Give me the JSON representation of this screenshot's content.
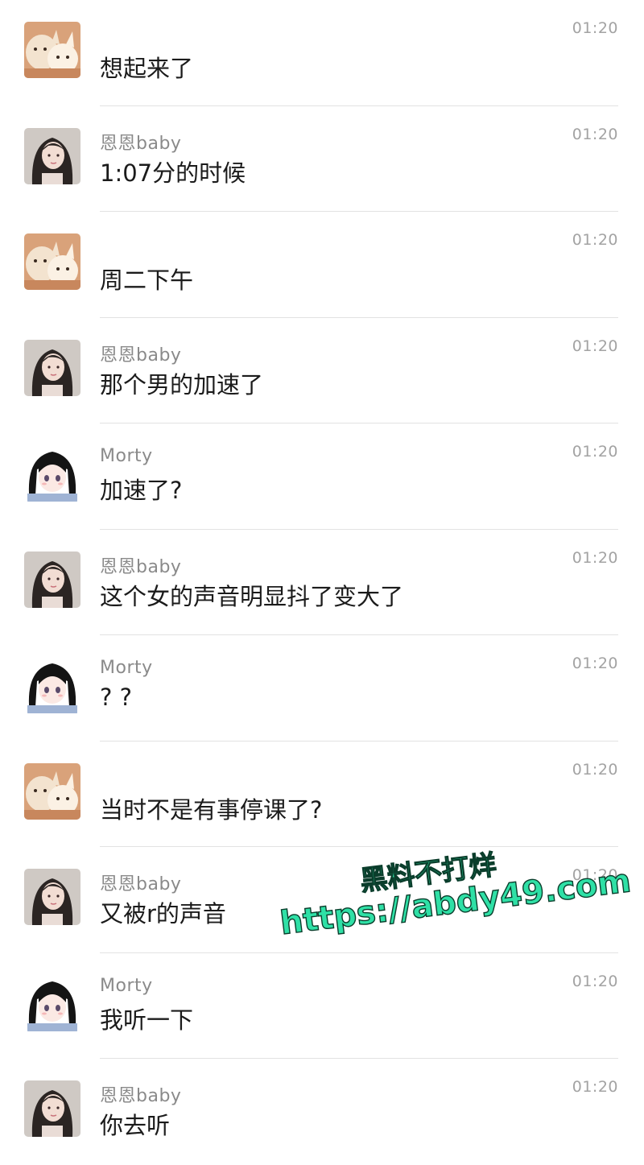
{
  "messages": [
    {
      "avatar": "cat",
      "sender": "",
      "text": "想起来了",
      "time": "01:20"
    },
    {
      "avatar": "girl",
      "sender": "恩恩baby",
      "text": "1:07分的时候",
      "time": "01:20"
    },
    {
      "avatar": "cat",
      "sender": "",
      "text": "周二下午",
      "time": "01:20"
    },
    {
      "avatar": "girl",
      "sender": "恩恩baby",
      "text": "那个男的加速了",
      "time": "01:20"
    },
    {
      "avatar": "anime",
      "sender": "Morty",
      "text": "加速了?",
      "time": "01:20"
    },
    {
      "avatar": "girl",
      "sender": "恩恩baby",
      "text": "这个女的声音明显抖了变大了",
      "time": "01:20"
    },
    {
      "avatar": "anime",
      "sender": "Morty",
      "text": "? ?",
      "time": "01:20"
    },
    {
      "avatar": "cat",
      "sender": "",
      "text": "当时不是有事停课了?",
      "time": "01:20"
    },
    {
      "avatar": "girl",
      "sender": "恩恩baby",
      "text": "又被r的声音",
      "time": "01:20"
    },
    {
      "avatar": "anime",
      "sender": "Morty",
      "text": "我听一下",
      "time": "01:20"
    },
    {
      "avatar": "girl",
      "sender": "恩恩baby",
      "text": "你去听",
      "time": "01:20"
    }
  ],
  "watermark": {
    "line1": "黑料不打烊",
    "line2": "https://abdy49.com"
  },
  "colors": {
    "sender": "#8a8a8a",
    "message": "#1b1b1b",
    "time": "#a3a3a3",
    "divider": "#e2e2e2",
    "watermark_fill": "#2fe0a6"
  }
}
